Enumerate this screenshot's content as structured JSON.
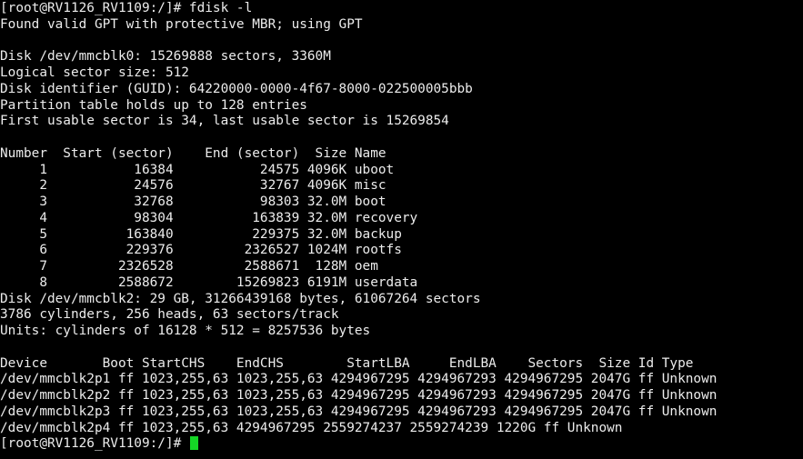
{
  "terminal": {
    "cursor_color": "#15d626",
    "text_color": "#ececec",
    "background_color": "#000000",
    "lines": [
      "[root@RV1126_RV1109:/]# fdisk -l",
      "Found valid GPT with protective MBR; using GPT",
      "",
      "Disk /dev/mmcblk0: 15269888 sectors, 3360M",
      "Logical sector size: 512",
      "Disk identifier (GUID): 64220000-0000-4f67-8000-022500005bbb",
      "Partition table holds up to 128 entries",
      "First usable sector is 34, last usable sector is 15269854",
      "",
      "Number  Start (sector)    End (sector)  Size Name",
      "     1           16384           24575 4096K uboot",
      "     2           24576           32767 4096K misc",
      "     3           32768           98303 32.0M boot",
      "     4           98304          163839 32.0M recovery",
      "     5          163840          229375 32.0M backup",
      "     6          229376         2326527 1024M rootfs",
      "     7         2326528         2588671  128M oem",
      "     8         2588672        15269823 6191M userdata",
      "Disk /dev/mmcblk2: 29 GB, 31266439168 bytes, 61067264 sectors",
      "3786 cylinders, 256 heads, 63 sectors/track",
      "Units: cylinders of 16128 * 512 = 8257536 bytes",
      "",
      "Device       Boot StartCHS    EndCHS        StartLBA     EndLBA    Sectors  Size Id Type",
      "/dev/mmcblk2p1 ff 1023,255,63 1023,255,63 4294967295 4294967293 4294967295 2047G ff Unknown",
      "/dev/mmcblk2p2 ff 1023,255,63 1023,255,63 4294967295 4294967293 4294967295 2047G ff Unknown",
      "/dev/mmcblk2p3 ff 1023,255,63 1023,255,63 4294967295 4294967293 4294967295 2047G ff Unknown",
      "/dev/mmcblk2p4 ff 1023,255,63 4294967295 2559274237 2559274239 1220G ff Unknown"
    ],
    "prompt": "[root@RV1126_RV1109:/]# "
  }
}
